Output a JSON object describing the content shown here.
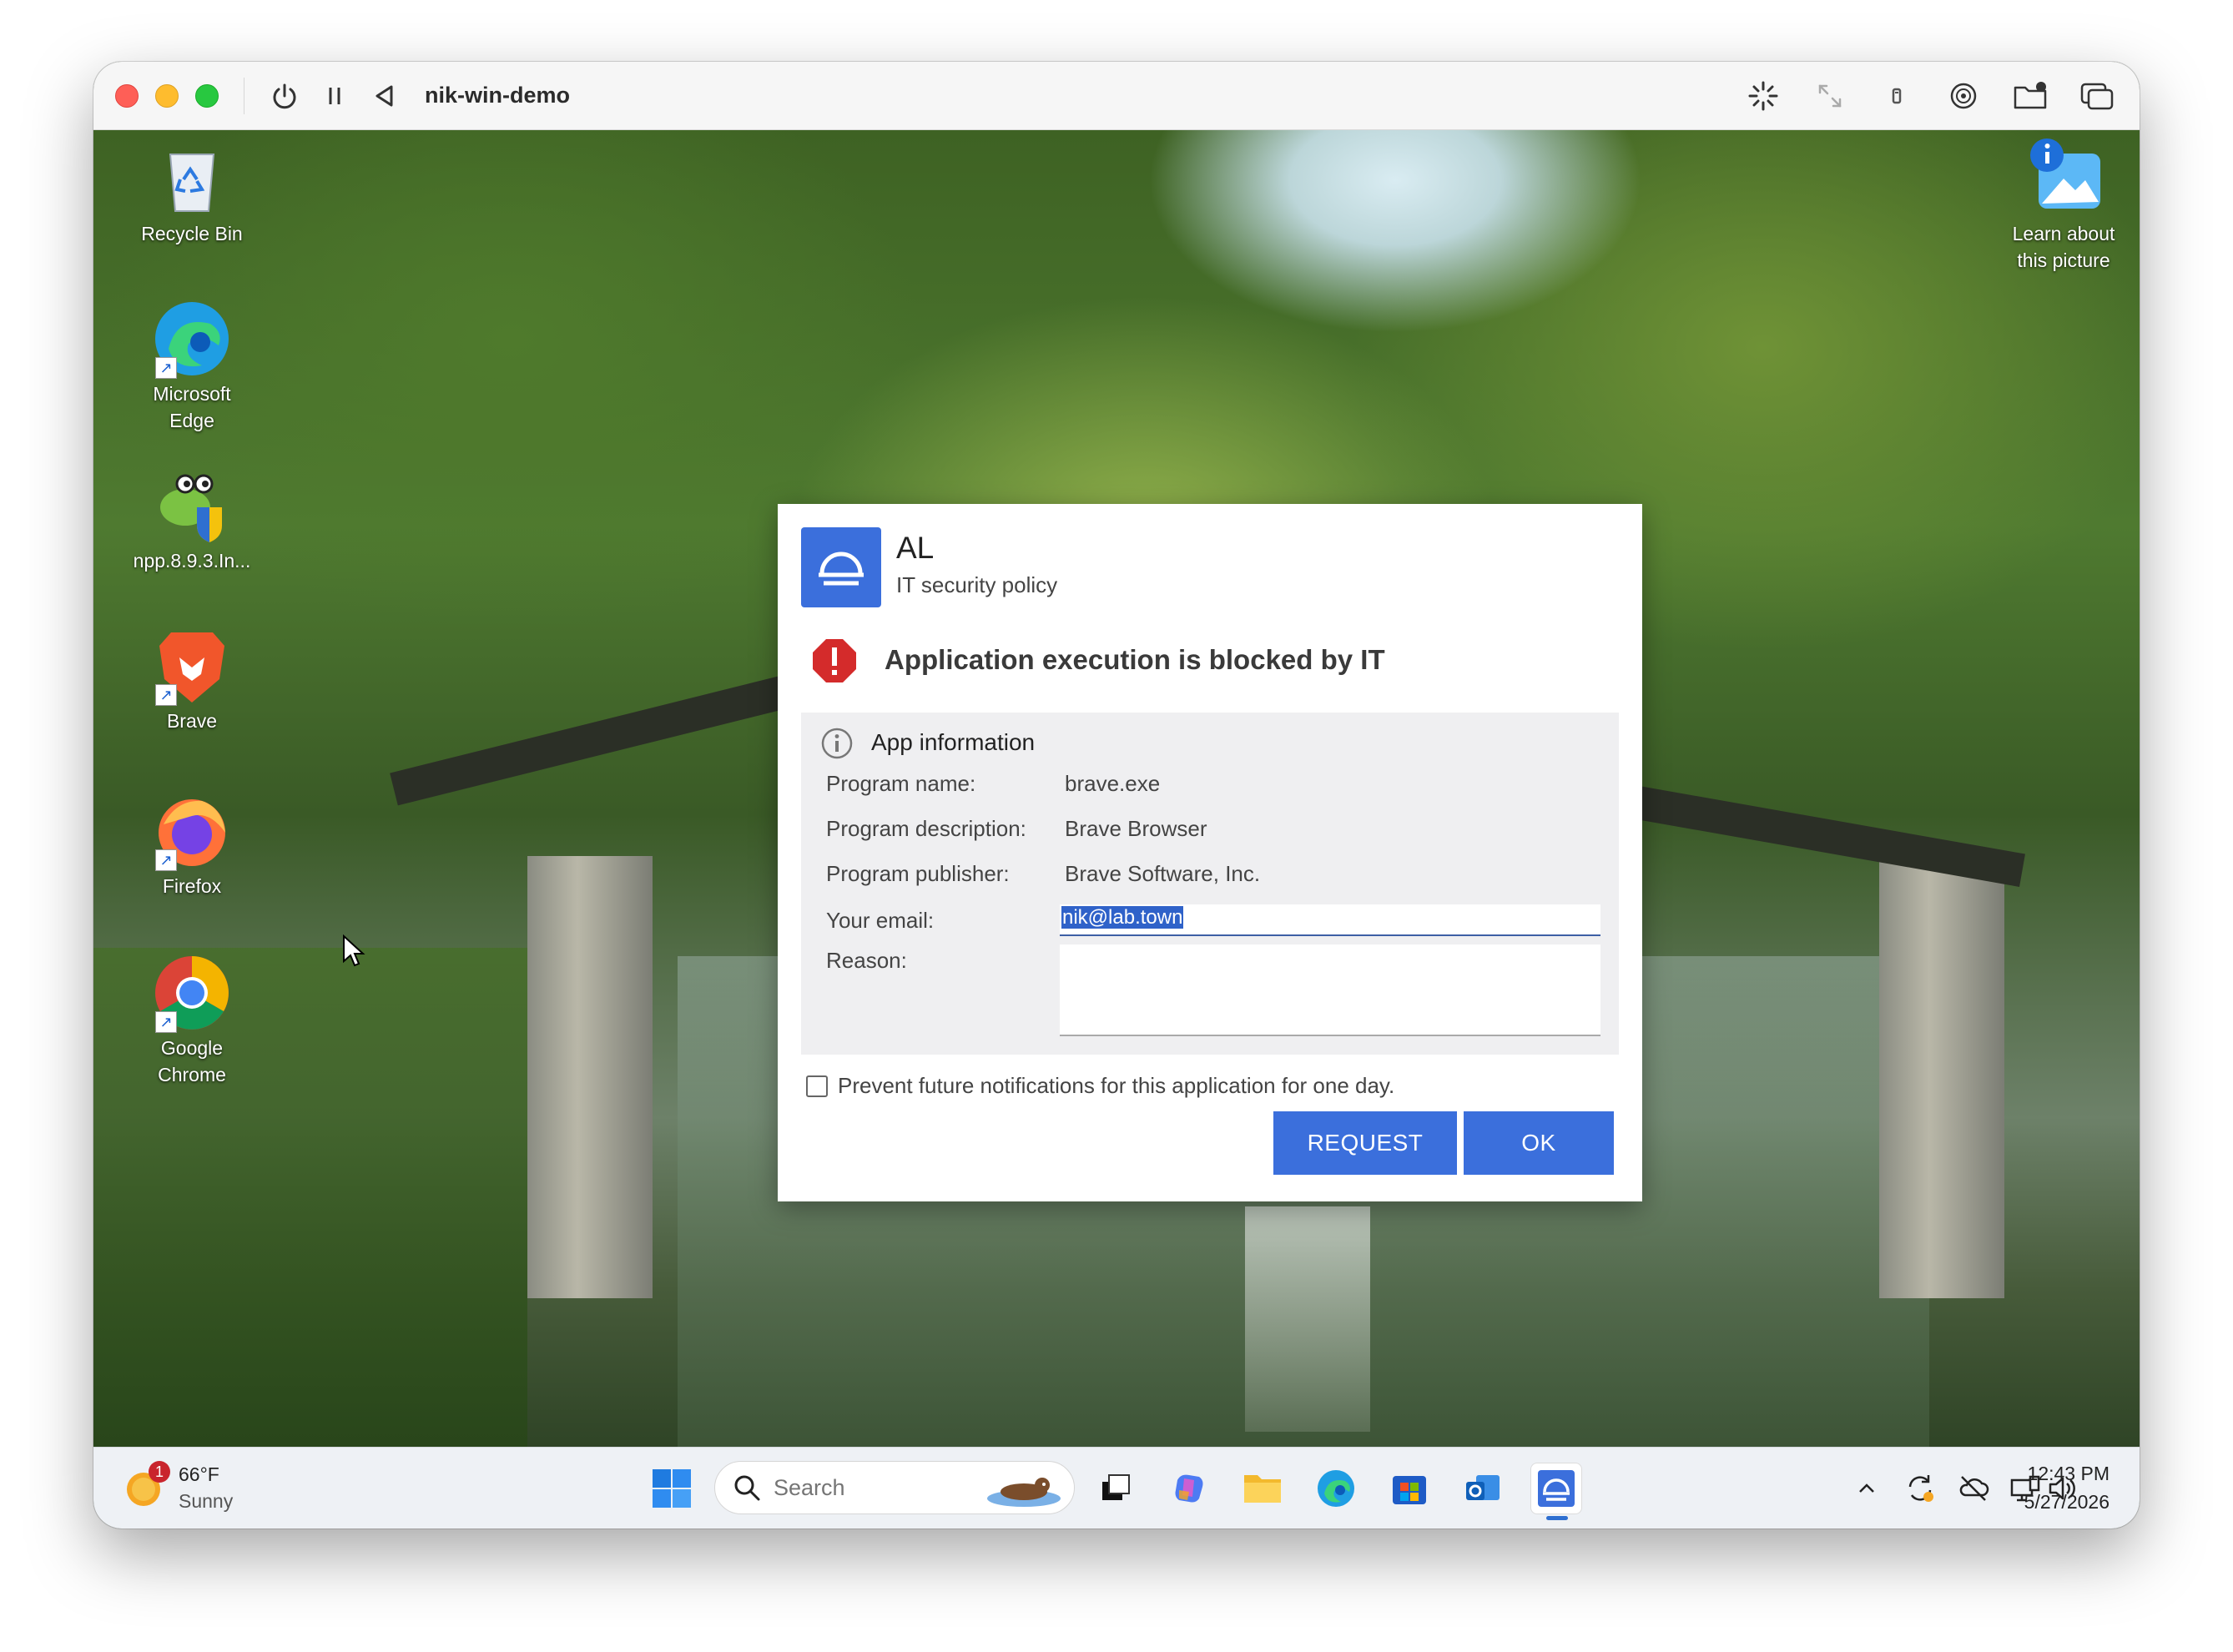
{
  "window": {
    "title": "nik-win-demo"
  },
  "desktop": {
    "icons": [
      {
        "label": "Recycle Bin"
      },
      {
        "label": "Microsoft Edge"
      },
      {
        "label": "npp.8.9.3.In..."
      },
      {
        "label": "Brave"
      },
      {
        "label": "Firefox"
      },
      {
        "label": "Google Chrome"
      }
    ],
    "learn_picture": "Learn about this picture"
  },
  "dialog": {
    "app_name": "AL",
    "subtitle": "IT security policy",
    "heading": "Application execution is blocked by IT",
    "info_title": "App information",
    "fields": {
      "program_name_label": "Program name:",
      "program_name_value": "brave.exe",
      "program_description_label": "Program description:",
      "program_description_value": "Brave Browser",
      "program_publisher_label": "Program publisher:",
      "program_publisher_value": "Brave Software, Inc.",
      "email_label": "Your email:",
      "email_value": "nik@lab.town",
      "reason_label": "Reason:",
      "reason_value": ""
    },
    "checkbox_label": "Prevent future notifications for this application for one day.",
    "request_label": "REQUEST",
    "ok_label": "OK",
    "colors": {
      "accent": "#3b6fdc",
      "alert": "#d42b2b"
    }
  },
  "taskbar": {
    "weather_temp": "66°F",
    "weather_desc": "Sunny",
    "weather_badge": "1",
    "search_placeholder": "Search",
    "time": "12:43 PM",
    "date": "5/27/2026"
  }
}
